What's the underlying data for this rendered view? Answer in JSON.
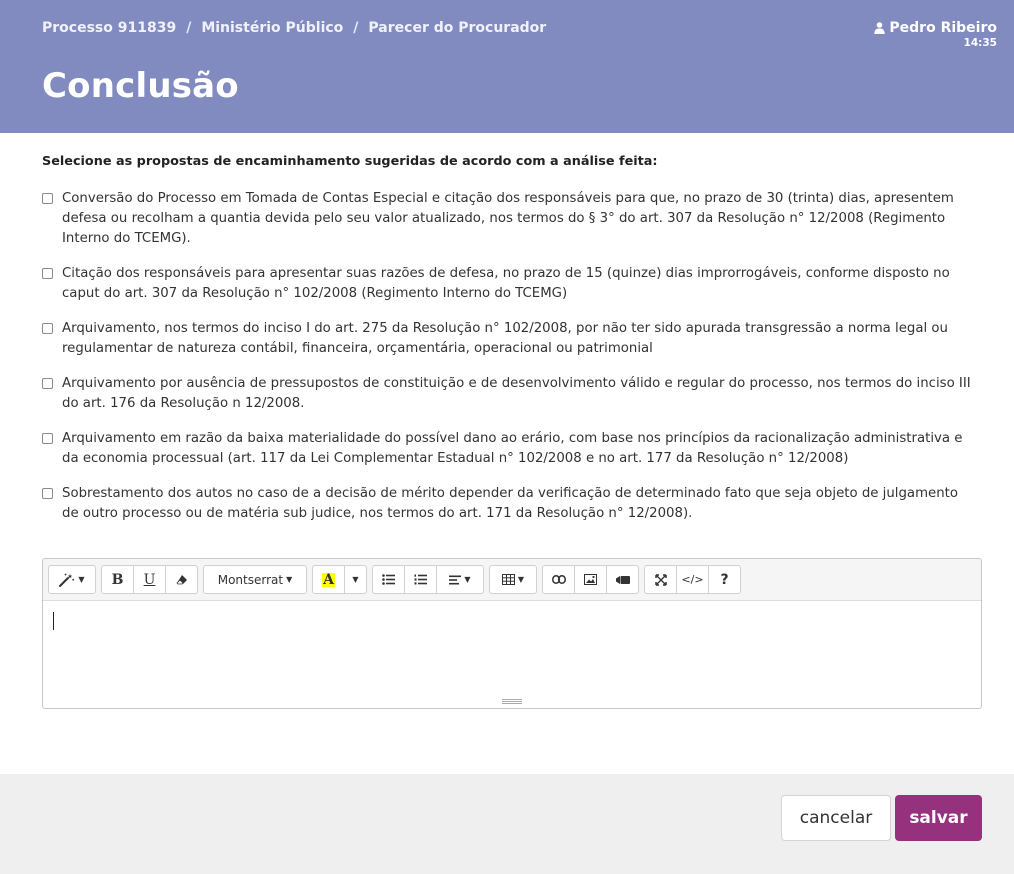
{
  "header": {
    "breadcrumb": [
      "Processo 911839",
      "Ministério Público",
      "Parecer do Procurador"
    ],
    "separator": "/",
    "user_name": "Pedro Ribeiro",
    "time": "14:35",
    "title": "Conclusão",
    "background_color": "#818bc0"
  },
  "instructions": "Selecione as propostas de encaminhamento sugeridas de acordo com a análise feita:",
  "options": [
    {
      "text": "Conversão do Processo em Tomada de Contas Especial e citação dos responsáveis para que, no prazo de 30 (trinta) dias, apresentem defesa ou recolham a quantia devida pelo seu valor atualizado, nos termos do § 3° do art. 307 da Resolução n° 12/2008 (Regimento Interno do TCEMG).",
      "checked": false
    },
    {
      "text": "Citação dos responsáveis para apresentar suas razões de defesa, no prazo de 15 (quinze) dias improrrogáveis, conforme disposto no caput do art. 307 da Resolução n° 102/2008 (Regimento Interno do TCEMG)",
      "checked": false
    },
    {
      "text": "Arquivamento, nos termos do inciso I do art. 275 da Resolução n° 102/2008, por não ter sido apurada transgressão a norma legal ou regulamentar de natureza contábil, financeira, orçamentária, operacional ou patrimonial",
      "checked": false
    },
    {
      "text": "Arquivamento por ausência de pressupostos de constituição e de desenvolvimento válido e regular do processo, nos termos do inciso III do art. 176 da Resolução n 12/2008.",
      "checked": false
    },
    {
      "text": "Arquivamento em razão da baixa materialidade do possível dano ao erário, com base nos princípios da racionalização administrativa e da economia processual (art. 117 da Lei Complementar Estadual n° 102/2008 e no art. 177 da Resolução n° 12/2008)",
      "checked": false
    },
    {
      "text": "Sobrestamento dos autos no caso de a decisão de mérito depender da verificação de determinado fato que seja objeto de julgamento de outro processo ou de matéria sub judice, nos termos do art. 171 da Resolução n° 12/2008).",
      "checked": false
    }
  ],
  "editor": {
    "font_name": "Montserrat",
    "bold_label": "B",
    "underline_label": "U",
    "highlight_label": "A",
    "highlight_color": "#ffff00",
    "code_label": "</>",
    "help_label": "?",
    "content": ""
  },
  "footer": {
    "cancel_label": "cancelar",
    "save_label": "salvar",
    "save_color": "#95317d"
  }
}
